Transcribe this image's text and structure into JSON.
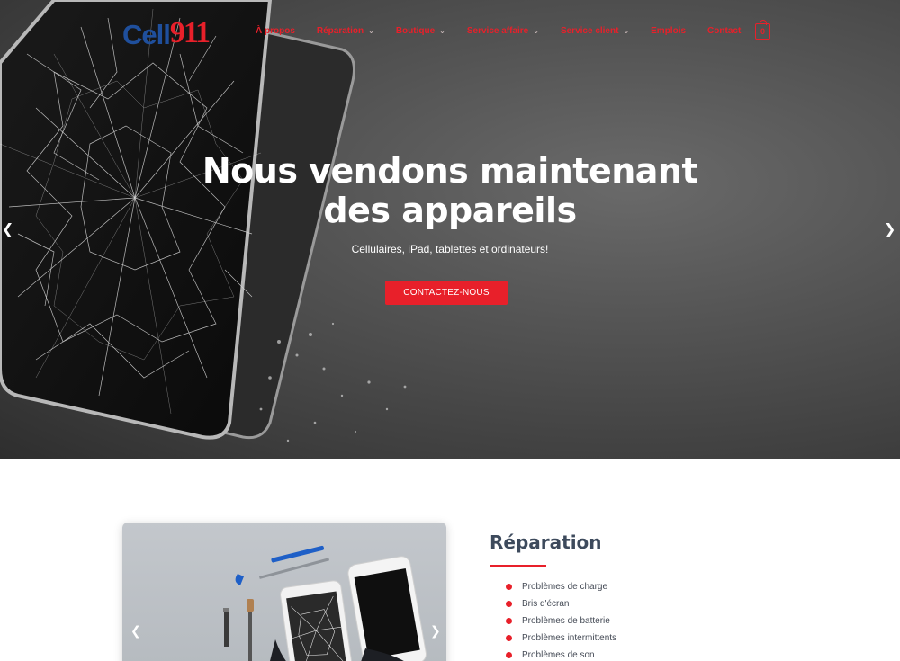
{
  "header": {
    "logo_prefix": "Cell",
    "logo_number": "911",
    "nav": [
      {
        "label": "À propos",
        "has_dropdown": false
      },
      {
        "label": "Réparation",
        "has_dropdown": true
      },
      {
        "label": "Boutique",
        "has_dropdown": true
      },
      {
        "label": "Service affaire",
        "has_dropdown": true
      },
      {
        "label": "Service client",
        "has_dropdown": true
      },
      {
        "label": "Emplois",
        "has_dropdown": false
      },
      {
        "label": "Contact",
        "has_dropdown": false
      }
    ],
    "cart_count": "0"
  },
  "hero": {
    "title_line1": "Nous vendons maintenant",
    "title_line2": "des appareils",
    "subtitle": "Cellulaires, iPad, tablettes et ordinateurs!",
    "cta_label": "CONTACTEZ-NOUS",
    "prev_icon": "chevron-left-icon",
    "next_icon": "chevron-right-icon"
  },
  "repair": {
    "title": "Réparation",
    "items": [
      "Problèmes de charge",
      "Bris d'écran",
      "Problèmes de batterie",
      "Problèmes intermittents",
      "Problèmes de son"
    ]
  },
  "colors": {
    "accent": "#e8202a",
    "logo_blue": "#1f4f9c",
    "heading": "#3d4a5c"
  }
}
